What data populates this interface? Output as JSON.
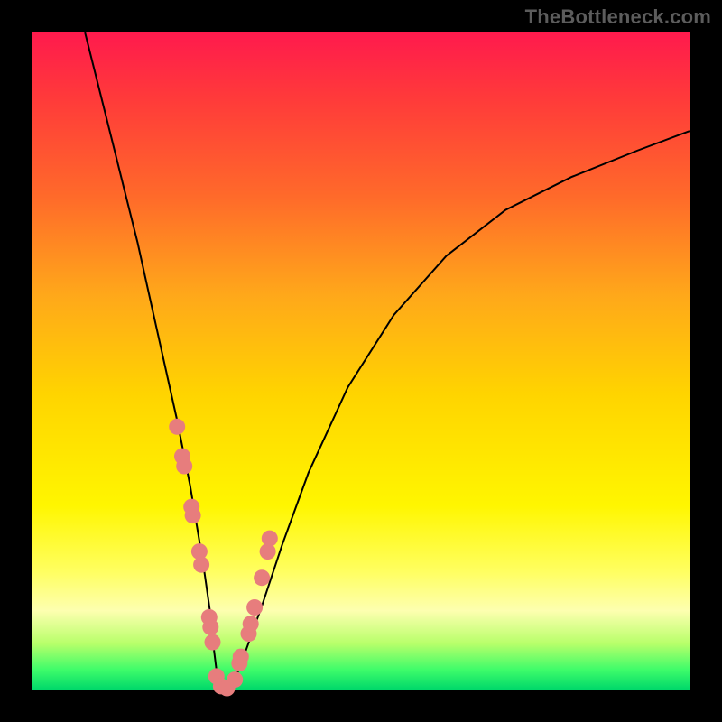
{
  "watermark": "TheBottleneck.com",
  "colors": {
    "dot": "#e77d7d",
    "curve": "#000000",
    "gradient_top": "#ff1a4d",
    "gradient_bottom": "#00d86a",
    "frame": "#000000"
  },
  "chart_data": {
    "type": "line",
    "title": "",
    "xlabel": "",
    "ylabel": "",
    "xlim": [
      0,
      100
    ],
    "ylim": [
      0,
      100
    ],
    "grid": false,
    "legend": false,
    "series": [
      {
        "name": "bottleneck-curve",
        "x": [
          8,
          10,
          12,
          14,
          16,
          18,
          20,
          22,
          24,
          25,
          26,
          27,
          27.5,
          28,
          28.5,
          29,
          30,
          31,
          32.5,
          35,
          38,
          42,
          48,
          55,
          63,
          72,
          82,
          92,
          100
        ],
        "y": [
          100,
          92,
          84,
          76,
          68,
          59,
          50,
          41,
          31,
          25,
          19,
          12,
          7,
          3,
          1,
          0,
          0,
          2,
          6,
          13,
          22,
          33,
          46,
          57,
          66,
          73,
          78,
          82,
          85
        ]
      }
    ],
    "highlight_points": {
      "name": "sample-dots",
      "x": [
        22.0,
        22.8,
        23.1,
        24.2,
        24.4,
        25.4,
        25.7,
        26.9,
        27.1,
        27.4,
        28.0,
        28.7,
        29.6,
        30.8,
        31.5,
        31.7,
        32.9,
        33.2,
        33.8,
        34.9,
        35.8,
        36.1
      ],
      "y": [
        40.0,
        35.5,
        34.0,
        27.8,
        26.5,
        21.0,
        19.0,
        11.0,
        9.5,
        7.2,
        2.0,
        0.5,
        0.2,
        1.5,
        4.0,
        5.0,
        8.5,
        10.0,
        12.5,
        17.0,
        21.0,
        23.0
      ]
    }
  }
}
